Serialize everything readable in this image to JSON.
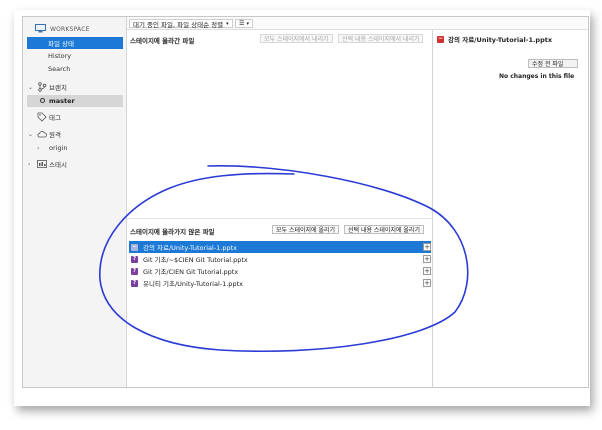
{
  "sidebar": {
    "workspace_label": "WORKSPACE",
    "workspace_items": [
      {
        "label": "파일 상태",
        "active": true
      },
      {
        "label": "History",
        "active": false
      },
      {
        "label": "Search",
        "active": false
      }
    ],
    "branches_label": "브랜치",
    "branch_master": "master",
    "tags_label": "태그",
    "remotes_label": "원격",
    "remote_origin": "origin",
    "stashes_label": "스태시"
  },
  "toolbar": {
    "sort_label": "대기 중인 파일, 파일 상태순 정렬"
  },
  "staged": {
    "title": "스테이지에 올라간 파일",
    "unstage_all": "모두 스테이지에서 내리기",
    "unstage_selected": "선택 내용 스테이지에서 내리기"
  },
  "unstaged": {
    "title": "스테이지에 올라가지 않은 파일",
    "stage_all": "모두 스테이지에 올리기",
    "stage_selected": "선택 내용 스테이지에 올리기",
    "files": [
      {
        "name": "강의 자료/Unity-Tutorial-1.pptx",
        "status": "−",
        "selected": true
      },
      {
        "name": "Git 기초/~$CIEN Git Tutorial.pptx",
        "status": "?",
        "selected": false
      },
      {
        "name": "Git 기초/CIEN Git Tutorial.pptx",
        "status": "?",
        "selected": false
      },
      {
        "name": "유니티 기초/Unity-Tutorial-1.pptx",
        "status": "?",
        "selected": false
      }
    ]
  },
  "diff": {
    "file_title": "강의 자료/Unity-Tutorial-1.pptx",
    "revert_label": "수정 전 파일",
    "no_changes": "No changes in this file"
  },
  "colors": {
    "accent": "#1c7ad6",
    "annotation": "#2a3bd6",
    "untracked": "#7a3fa0",
    "removed": "#d03030"
  }
}
